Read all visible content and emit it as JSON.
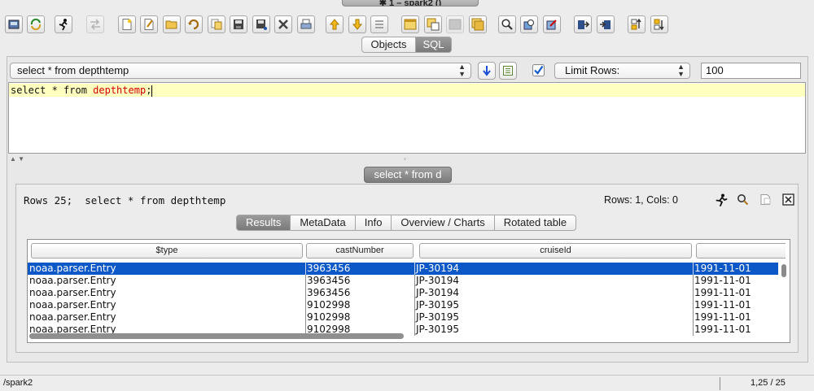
{
  "window": {
    "title": "✱ 1 – spark2 ()"
  },
  "toolbar": {
    "buttons": [
      {
        "icon": "db-connect-icon"
      },
      {
        "icon": "refresh-icon"
      },
      {
        "icon": "run-icon"
      },
      {
        "icon": "transfer-icon"
      },
      {
        "icon": "new-file-icon"
      },
      {
        "icon": "edit-file-icon"
      },
      {
        "icon": "open-folder-icon"
      },
      {
        "icon": "undo-icon"
      },
      {
        "icon": "copy-file-icon"
      },
      {
        "icon": "save-icon"
      },
      {
        "icon": "save-as-icon"
      },
      {
        "icon": "delete-icon"
      },
      {
        "icon": "print-icon"
      },
      {
        "icon": "arrow-up-icon"
      },
      {
        "icon": "arrow-down-icon"
      },
      {
        "icon": "list-icon"
      },
      {
        "icon": "window-icon"
      },
      {
        "icon": "window-copy-icon"
      },
      {
        "icon": "window-gray-icon"
      },
      {
        "icon": "window-stack-icon"
      },
      {
        "icon": "search-icon"
      },
      {
        "icon": "zoom-tool-icon"
      },
      {
        "icon": "zoom-settings-icon"
      },
      {
        "icon": "import-icon"
      },
      {
        "icon": "export-icon"
      },
      {
        "icon": "sort-asc-icon"
      },
      {
        "icon": "sort-desc-icon"
      }
    ]
  },
  "top_tabs": [
    {
      "label": "Objects",
      "active": false
    },
    {
      "label": "SQL",
      "active": true
    }
  ],
  "query_combo": {
    "value": "select * from depthtemp"
  },
  "limit": {
    "checked": true,
    "mode": "Limit Rows:",
    "value": "100"
  },
  "editor": {
    "keyword": "select * from ",
    "table": "depthtemp",
    "terminator": ";"
  },
  "result_tab": {
    "label": "select * from d"
  },
  "results": {
    "rows_label": "Rows 25;  select * from depthtemp",
    "rows_cols": "Rows: 1, Cols: 0",
    "tabs": [
      {
        "label": "Results",
        "active": true
      },
      {
        "label": "MetaData",
        "active": false
      },
      {
        "label": "Info",
        "active": false
      },
      {
        "label": "Overview / Charts",
        "active": false
      },
      {
        "label": "Rotated table",
        "active": false
      }
    ],
    "columns": [
      "$type",
      "castNumber",
      "cruiseId",
      ""
    ],
    "rows": [
      [
        "noaa.parser.Entry",
        "3963456",
        "JP-30194",
        "1991-11-01"
      ],
      [
        "noaa.parser.Entry",
        "3963456",
        "JP-30194",
        "1991-11-01"
      ],
      [
        "noaa.parser.Entry",
        "3963456",
        "JP-30194",
        "1991-11-01"
      ],
      [
        "noaa.parser.Entry",
        "9102998",
        "JP-30195",
        "1991-11-01"
      ],
      [
        "noaa.parser.Entry",
        "9102998",
        "JP-30195",
        "1991-11-01"
      ],
      [
        "noaa.parser.Entry",
        "9102998",
        "JP-30195",
        "1991-11-01"
      ]
    ]
  },
  "status": {
    "path": "/spark2",
    "position": "1,25 / 25"
  }
}
